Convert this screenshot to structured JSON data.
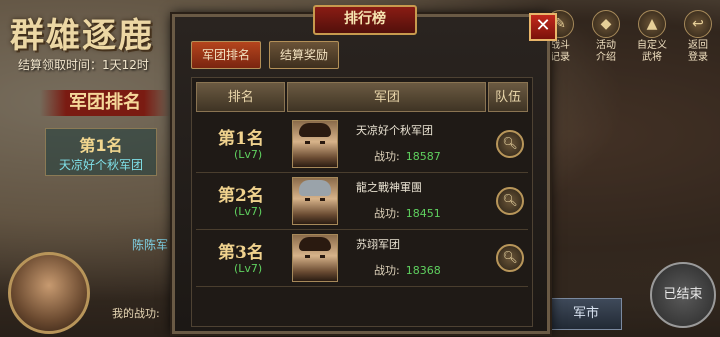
{
  "background": {
    "game_title": "群雄逐鹿",
    "reward_time": "结算领取时间：1天12时",
    "legion_rank_title": "军团排名",
    "first_place": {
      "rank": "第1名",
      "name": "天凉好个秋军团"
    },
    "player_name": "陈陈军",
    "my_merit_label": "我的战功:",
    "menu": [
      {
        "label_line1": "战斗",
        "label_line2": "记录",
        "icon": "scroll-icon"
      },
      {
        "label_line1": "活动",
        "label_line2": "介绍",
        "icon": "info-icon"
      },
      {
        "label_line1": "自定义",
        "label_line2": "武将",
        "icon": "helmet-icon"
      },
      {
        "label_line1": "返回",
        "label_line2": "登录",
        "icon": "return-icon"
      }
    ],
    "ended_label": "已结束",
    "market_label": "军市"
  },
  "panel": {
    "title": "排行榜",
    "close_glyph": "✕",
    "tabs": [
      {
        "label": "军团排名",
        "active": true
      },
      {
        "label": "结算奖励",
        "active": false
      }
    ],
    "headers": {
      "rank": "排名",
      "legion": "军团",
      "team": "队伍"
    },
    "merit_label": "战功:",
    "rows": [
      {
        "rank": "第1名",
        "level": "(Lv7)",
        "legion": "天凉好个秋军团",
        "merit": "18587",
        "avatar": "general-face-1"
      },
      {
        "rank": "第2名",
        "level": "(Lv7)",
        "legion": "龍之戰神軍團",
        "merit": "18451",
        "avatar": "general-face-2"
      },
      {
        "rank": "第3名",
        "level": "(Lv7)",
        "legion": "苏翊军团",
        "merit": "18368",
        "avatar": "general-face-3"
      }
    ]
  }
}
